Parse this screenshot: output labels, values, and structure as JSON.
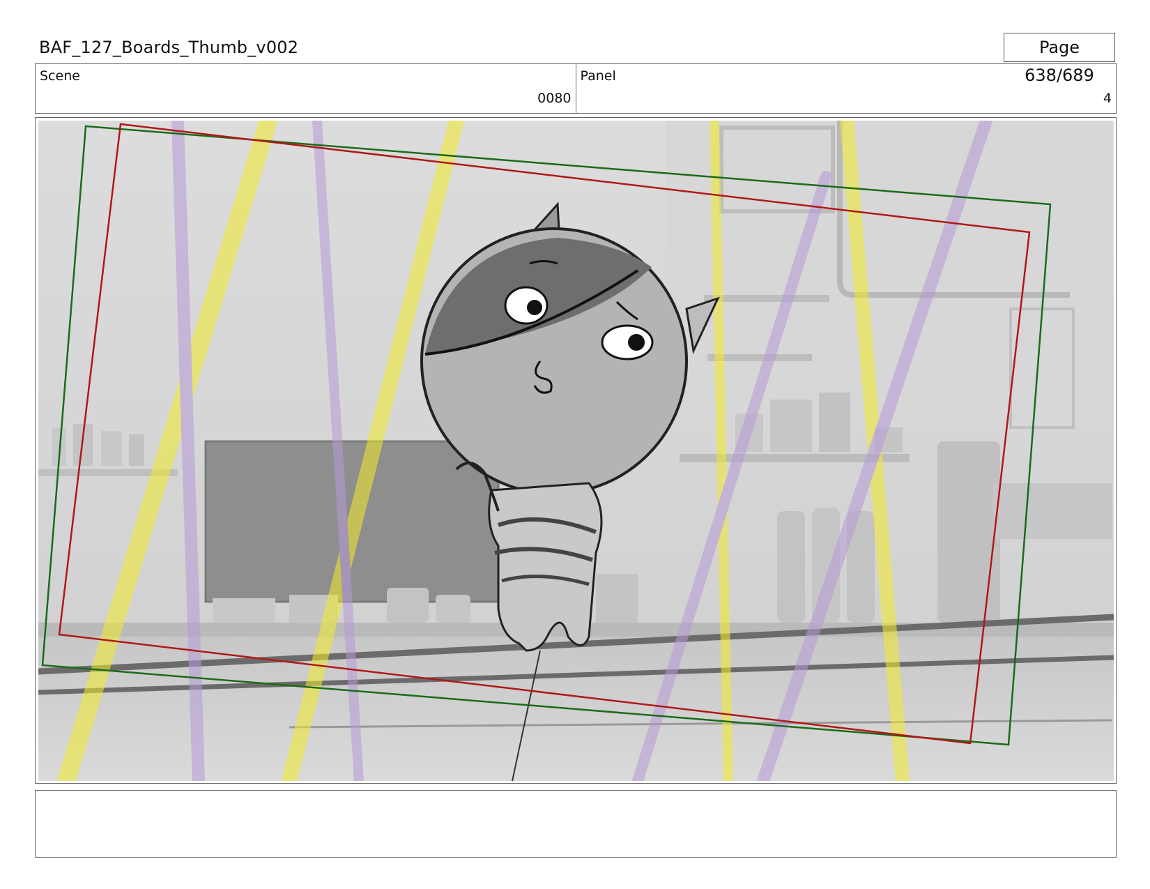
{
  "header": {
    "doc_title": "BAF_127_Boards_Thumb_v002",
    "page_label": "Page 638/689"
  },
  "info": {
    "scene_label": "Scene",
    "scene_value": "0080",
    "panel_label": "Panel",
    "panel_value": "4"
  },
  "panel_image": {
    "description_icon": "storyboard-sketch-cat-character-kitchen",
    "camera_frame_colors": {
      "outer": "#1a6b1a",
      "inner": "#b01818"
    }
  },
  "notes": {
    "text": ""
  }
}
